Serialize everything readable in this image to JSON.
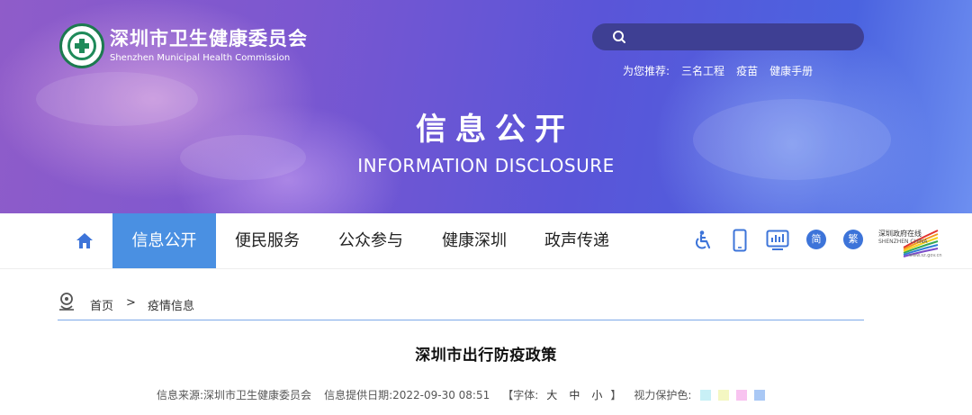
{
  "header": {
    "org_name_cn": "深圳市卫生健康委员会",
    "org_name_en": "Shenzhen Municipal Health Commission",
    "search": {
      "placeholder": "",
      "value": ""
    },
    "recommend_label": "为您推荐:",
    "recommend_links": [
      "三名工程",
      "疫苗",
      "健康手册"
    ]
  },
  "hero": {
    "title_cn": "信息公开",
    "title_en": "INFORMATION DISCLOSURE"
  },
  "nav": {
    "items": [
      "信息公开",
      "便民服务",
      "公众参与",
      "健康深圳",
      "政声传递"
    ],
    "active_index": 0,
    "tools": {
      "simplified_label": "简",
      "traditional_label": "繁"
    },
    "portal": {
      "name_cn": "深圳政府在线",
      "name_en": "SHENZHEN CHINA",
      "url": "www.sz.gov.cn"
    }
  },
  "breadcrumb": {
    "home": "首页",
    "separator": ">",
    "current": "疫情信息"
  },
  "article": {
    "title": "深圳市出行防疫政策",
    "source_label": "信息来源:",
    "source": "深圳市卫生健康委员会",
    "date_label": "信息提供日期:",
    "date": "2022-09-30 08:51",
    "font_label": "【字体:",
    "font_large": "大",
    "font_medium": "中",
    "font_small": "小",
    "font_close": "】",
    "eye_label": "视力保护色:",
    "eye_colors": [
      "#c8f0f6",
      "#f4f7c2",
      "#f8c3f0",
      "#a9c8f5"
    ]
  },
  "colors": {
    "nav_active": "#4a90e2",
    "tool_round": "#3d74d9",
    "breadcrumb_line": "#7da9e8"
  }
}
